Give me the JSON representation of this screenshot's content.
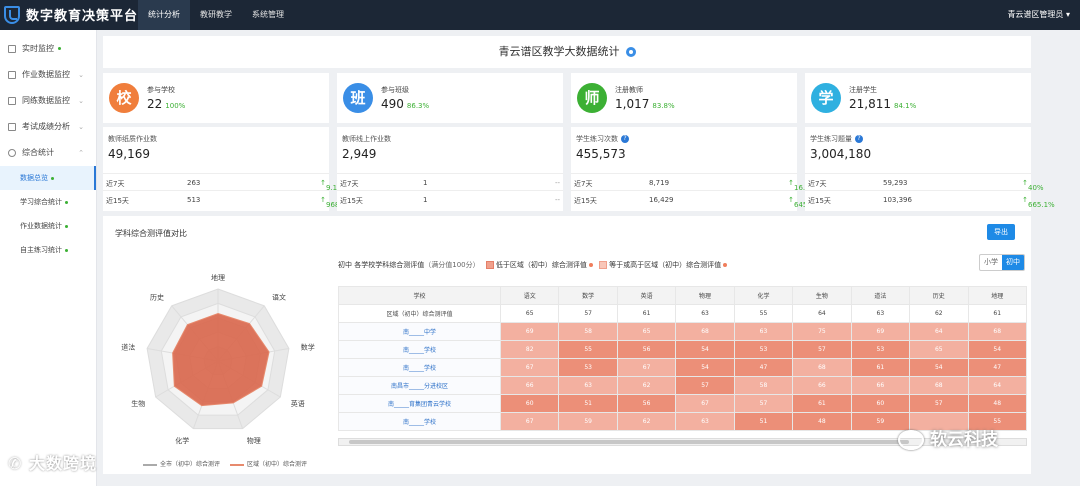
{
  "app": {
    "title": "数字教育决策平台"
  },
  "nav": [
    "统计分析",
    "教研教学",
    "系统管理"
  ],
  "user": "青云谱区管理员",
  "sidebar": {
    "items": [
      {
        "label": "实时监控"
      },
      {
        "label": "作业数据监控"
      },
      {
        "label": "同练数据监控"
      },
      {
        "label": "考试成绩分析"
      },
      {
        "label": "综合统计"
      }
    ],
    "sub": [
      {
        "label": "数据总览"
      },
      {
        "label": "学习综合统计"
      },
      {
        "label": "作业数据统计"
      },
      {
        "label": "自主练习统计"
      }
    ]
  },
  "page": {
    "title": "青云谱区教学大数据统计"
  },
  "stats": [
    {
      "icon": "校",
      "label": "参与学校",
      "value": "22",
      "pct": "100%",
      "color": "#f07e3c"
    },
    {
      "icon": "班",
      "label": "参与班级",
      "value": "490",
      "pct": "86.3%",
      "color": "#3a8ee6"
    },
    {
      "icon": "师",
      "label": "注册教师",
      "value": "1,017",
      "pct": "83.8%",
      "color": "#3cb034"
    },
    {
      "icon": "学",
      "label": "注册学生",
      "value": "21,811",
      "pct": "84.1%",
      "color": "#2fb0e0"
    }
  ],
  "details": [
    {
      "label": "教师纸质作业数",
      "value": "49,169",
      "r1": [
        "近7天",
        "263",
        "9.1%"
      ],
      "r2": [
        "近15天",
        "513",
        "968.8%"
      ]
    },
    {
      "label": "教师线上作业数",
      "value": "2,949",
      "r1": [
        "近7天",
        "1",
        "--"
      ],
      "r2": [
        "近15天",
        "1",
        "--"
      ]
    },
    {
      "label": "学生练习次数",
      "value": "455,573",
      "r1": [
        "近7天",
        "8,719",
        "16.7%"
      ],
      "r2": [
        "近15天",
        "16,429",
        "645.4%"
      ]
    },
    {
      "label": "学生练习题量",
      "value": "3,004,180",
      "r1": [
        "近7天",
        "59,293",
        "40%"
      ],
      "r2": [
        "近15天",
        "103,396",
        "665.1%"
      ]
    }
  ],
  "section": {
    "title": "学科综合测评值对比",
    "export": "导出",
    "chart_title": "初中 各学校学科综合测评值",
    "chart_sub": "（满分值100分）",
    "legend_low": "低于区域（初中）综合测评值",
    "legend_high": "等于或高于区域（初中）综合测评值",
    "seg": [
      "小学",
      "初中"
    ],
    "radar_legend": [
      "全市（初中）综合测评",
      "区域（初中）综合测评"
    ]
  },
  "radar": {
    "axes": [
      "地理",
      "语文",
      "数学",
      "英语",
      "物理",
      "化学",
      "生物",
      "道法",
      "历史"
    ]
  },
  "table": {
    "headers": [
      "学校",
      "语文",
      "数学",
      "英语",
      "物理",
      "化学",
      "生物",
      "道法",
      "历史",
      "地理"
    ],
    "region_label": "区域（初中）综合测评值",
    "region": [
      "65",
      "57",
      "61",
      "63",
      "55",
      "64",
      "63",
      "62",
      "61"
    ],
    "rows": [
      {
        "name": "南_____中学",
        "v": [
          "69",
          "58",
          "65",
          "68",
          "63",
          "75",
          "69",
          "64",
          "68"
        ]
      },
      {
        "name": "南_____学校",
        "v": [
          "82",
          "55",
          "56",
          "54",
          "53",
          "57",
          "53",
          "65",
          "54"
        ]
      },
      {
        "name": "南_____学校",
        "v": [
          "67",
          "53",
          "67",
          "54",
          "47",
          "68",
          "61",
          "54",
          "47"
        ]
      },
      {
        "name": "南昌市_____分进校区",
        "v": [
          "66",
          "63",
          "62",
          "57",
          "58",
          "66",
          "66",
          "68",
          "64"
        ]
      },
      {
        "name": "南_____育集团青云学校",
        "v": [
          "60",
          "51",
          "56",
          "67",
          "57",
          "61",
          "60",
          "57",
          "48"
        ]
      },
      {
        "name": "南_____学校",
        "v": [
          "67",
          "59",
          "62",
          "63",
          "51",
          "48",
          "59",
          "",
          "55"
        ]
      }
    ]
  },
  "watermarks": [
    "大数跨境",
    "软云科技"
  ]
}
